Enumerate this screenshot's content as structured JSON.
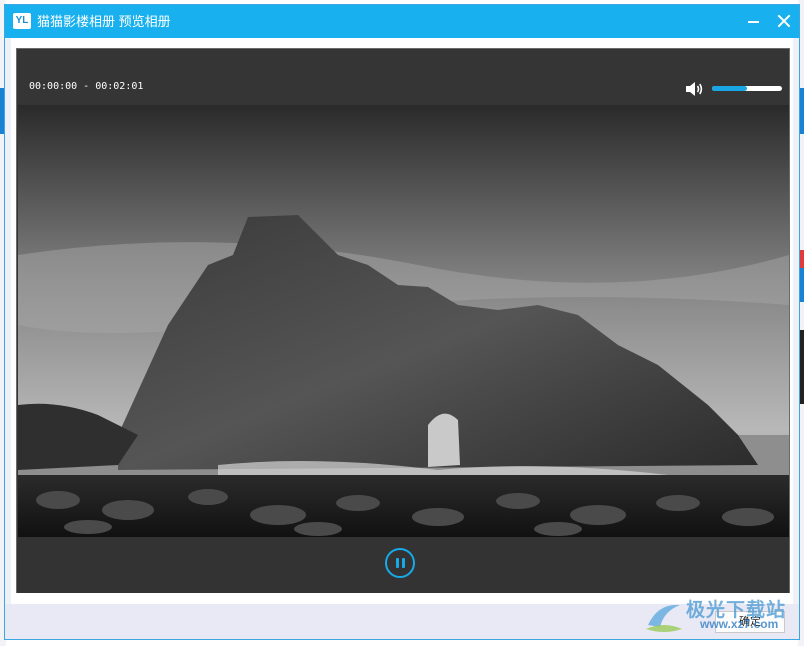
{
  "window": {
    "logo_text": "YL",
    "title": "猫猫影楼相册 预览相册"
  },
  "player": {
    "time": "00:00:00 - 00:02:01",
    "volume_level": 0.5,
    "state": "playing"
  },
  "footer": {
    "ok_label": "确定"
  },
  "watermark": {
    "title": "极光下载站",
    "url": "www.xz7.com"
  },
  "colors": {
    "titlebar": "#18b0ee",
    "accent": "#1aa6e4",
    "player_bg": "#333333"
  },
  "icons": [
    "app-logo-icon",
    "minimize-icon",
    "close-icon",
    "volume-icon",
    "pause-icon"
  ]
}
